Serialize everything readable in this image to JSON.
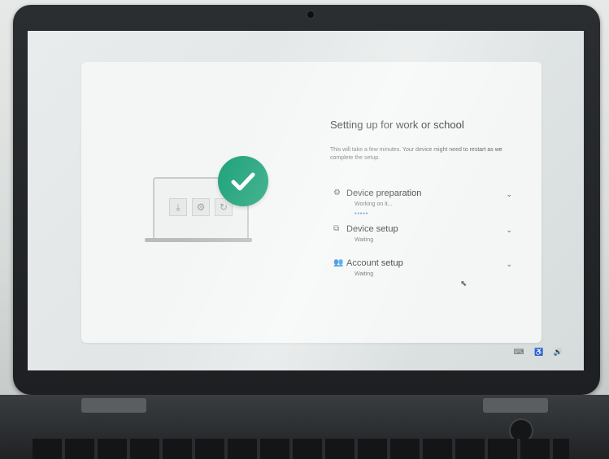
{
  "setup": {
    "title": "Setting up for work or school",
    "subtitle": "This will take a few minutes. Your device might need to restart as we complete the setup.",
    "steps": [
      {
        "title": "Device preparation",
        "status": "Working on it...",
        "icon": "gear-icon",
        "progress_indicator": "•••••"
      },
      {
        "title": "Device setup",
        "status": "Waiting",
        "icon": "devices-icon"
      },
      {
        "title": "Account setup",
        "status": "Waiting",
        "icon": "people-icon"
      }
    ]
  },
  "illustration": {
    "icons": [
      "download-icon",
      "gear-icon",
      "refresh-icon"
    ],
    "check_color": "#1fa37a"
  },
  "system_tray": {
    "icons": [
      "keyboard-icon",
      "accessibility-icon",
      "volume-icon"
    ]
  }
}
